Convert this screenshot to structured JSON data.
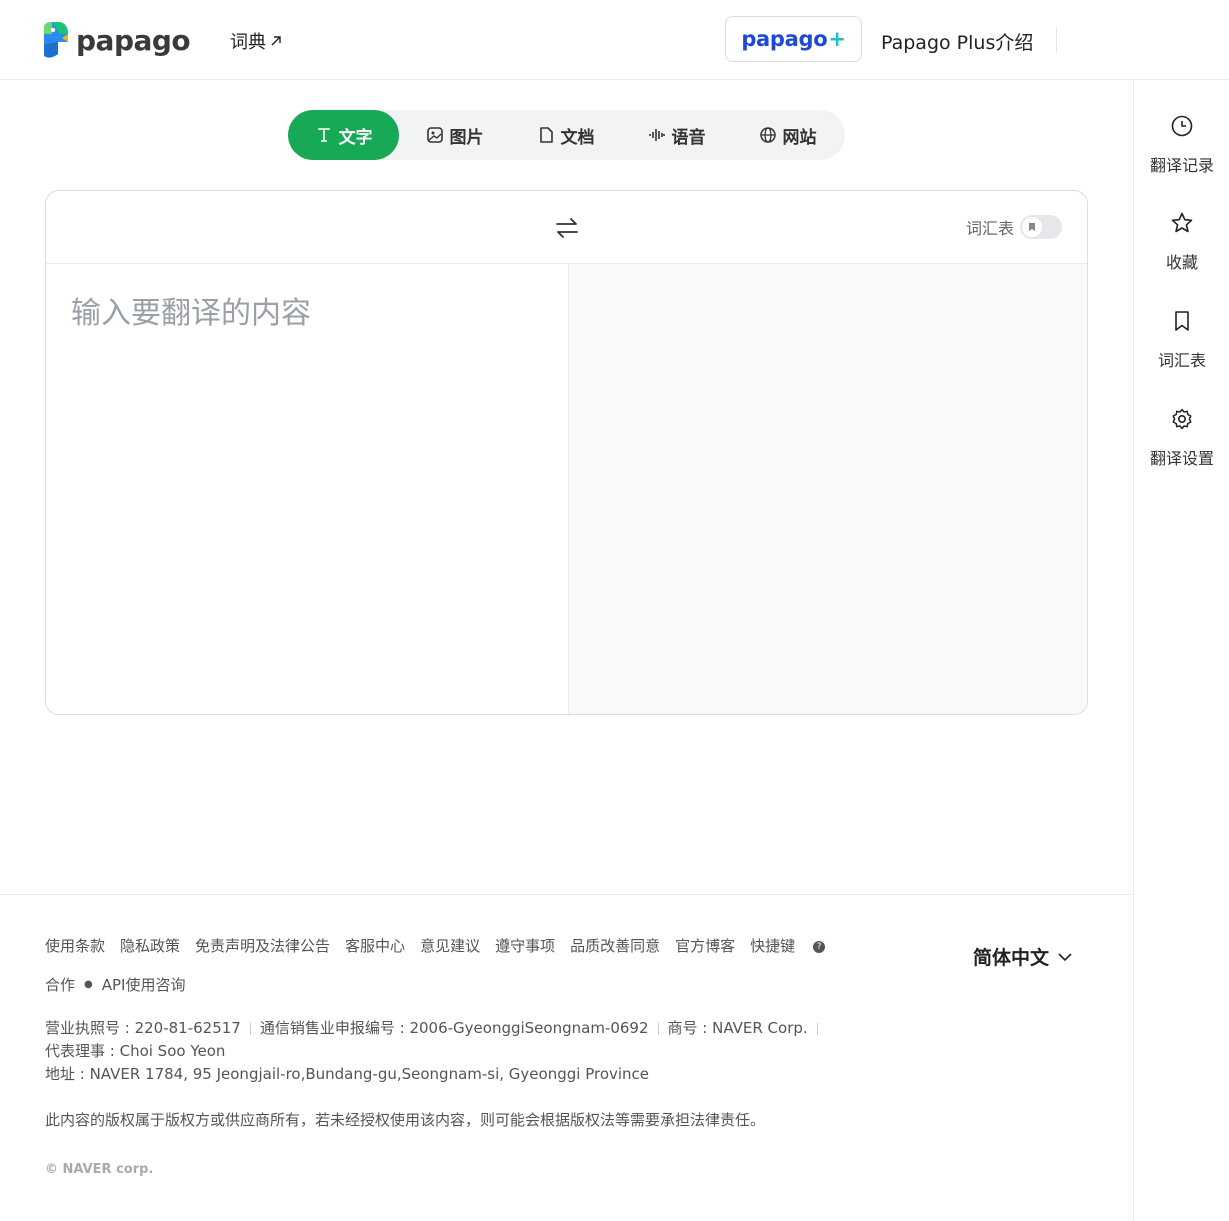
{
  "header": {
    "logo_text": "papago",
    "dict_label": "词典",
    "plus_button": {
      "main": "papago",
      "plus": "+"
    },
    "plus_intro": "Papago Plus介绍"
  },
  "tabs": [
    {
      "label": "文字",
      "icon": "text-icon",
      "active": true
    },
    {
      "label": "图片",
      "icon": "image-icon",
      "active": false
    },
    {
      "label": "文档",
      "icon": "document-icon",
      "active": false
    },
    {
      "label": "语音",
      "icon": "voice-icon",
      "active": false
    },
    {
      "label": "网站",
      "icon": "globe-icon",
      "active": false
    }
  ],
  "translator": {
    "glossary_label": "词汇表",
    "glossary_enabled": false,
    "source_placeholder": "输入要翻译的内容",
    "source_value": "",
    "target_value": ""
  },
  "sidebar": {
    "items": [
      {
        "label": "翻译记录",
        "icon": "clock-icon"
      },
      {
        "label": "收藏",
        "icon": "star-icon"
      },
      {
        "label": "词汇表",
        "icon": "bookmark-icon"
      },
      {
        "label": "翻译设置",
        "icon": "gear-icon"
      }
    ]
  },
  "footer": {
    "links": [
      "使用条款",
      "隐私政策",
      "免责声明及法律公告",
      "客服中心",
      "意见建议",
      "遵守事项",
      "品质改善同意",
      "官方博客",
      "快捷键"
    ],
    "links2": [
      "合作",
      "API使用咨询"
    ],
    "business_license": "营业执照号 : 220-81-62517",
    "telecom_reg": "通信销售业申报编号 : 2006-GyeonggiSeongnam-0692",
    "trade_name": "商号 : NAVER Corp.",
    "ceo": "代表理事 : Choi Soo Yeon",
    "address": "地址 : NAVER 1784, 95 Jeongjail-ro,Bundang-gu,Seongnam-si, Gyeonggi Province",
    "copyright_note": "此内容的版权属于版权方或供应商所有，若未经授权使用该内容，则可能会根据版权法等需要承担法律责任。",
    "naver_copyright": "NAVER corp.",
    "language": "简体中文"
  },
  "colors": {
    "accent_green": "#18a957",
    "plus_blue": "#1c49d6",
    "plus_teal": "#17c3c8"
  }
}
